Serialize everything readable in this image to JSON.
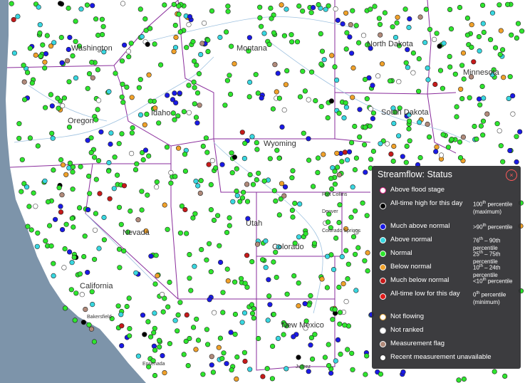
{
  "map": {
    "state_labels": [
      "Washington",
      "Montana",
      "North Dakota",
      "Minnesota",
      "Oregon",
      "Idaho",
      "South Dakota",
      "Wyoming",
      "Nevada",
      "Utah",
      "Colorado",
      "California",
      "New Mexico"
    ],
    "city_labels": [
      "Fort Collins",
      "Denver",
      "Colorado Springs",
      "Bakersfield",
      "Ensenada",
      "Juárez"
    ],
    "colors": {
      "ocean": "#7d94aa",
      "land": "#ffffff",
      "state_border": "#8a2d9c",
      "river": "#9fc2e0"
    }
  },
  "legend": {
    "title": "Streamflow: Status",
    "close_glyph": "×",
    "items": [
      {
        "label": "Above flood stage",
        "range": "",
        "color": "#ffffff",
        "border": "#e6268a",
        "range_sup": "",
        "range_main": "",
        "range_note": ""
      },
      {
        "label": "All-time high for this day",
        "range_main": "100",
        "range_sup": "th",
        "range_rest": " percentile",
        "range_note": "(maximum)",
        "color": "#000000",
        "border": "#ffffff"
      },
      {
        "label": "Much above normal",
        "range_main": ">90",
        "range_sup": "th",
        "range_rest": " percentile",
        "range_note": "",
        "color": "#1a1ae6",
        "border": "#ffffff"
      },
      {
        "label": "Above normal",
        "range_main": "76",
        "range_sup": "th",
        "range_rest": " – 90th percentile",
        "range_note": "",
        "color": "#38d7e0",
        "border": "#ffffff"
      },
      {
        "label": "Normal",
        "range_main": "25",
        "range_sup": "th",
        "range_rest": " – 75th percentile",
        "range_note": "",
        "color": "#2ee62e",
        "border": "#ffffff"
      },
      {
        "label": "Below normal",
        "range_main": "10",
        "range_sup": "th",
        "range_rest": " – 24th percentile",
        "range_note": "",
        "color": "#f0a12a",
        "border": "#ffffff"
      },
      {
        "label": "Much below normal",
        "range_main": "<10",
        "range_sup": "th",
        "range_rest": " percentile",
        "range_note": "",
        "color": "#c61a1a",
        "border": "#ffffff"
      },
      {
        "label": "All-time low for this day",
        "range_main": "0",
        "range_sup": "th",
        "range_rest": " percentile",
        "range_note": "(minimum)",
        "color": "#e01a1a",
        "border": "#ffffff"
      },
      {
        "label": "Not flowing",
        "range_main": "",
        "range_sup": "",
        "range_rest": "",
        "range_note": "",
        "color": "#ffffff",
        "border": "#f2b54a"
      },
      {
        "label": "Not ranked",
        "range_main": "",
        "range_sup": "",
        "range_rest": "",
        "range_note": "",
        "color": "#ffffff",
        "border": "#cccccc"
      },
      {
        "label": "Measurement flag",
        "range_main": "",
        "range_sup": "",
        "range_rest": "",
        "range_note": "",
        "color": "#b08a7a",
        "border": "#ffffff"
      },
      {
        "label": "Recent measurement unavailable",
        "range_main": "",
        "range_sup": "",
        "range_rest": "",
        "range_note": "",
        "color": "#ffffff",
        "border": "#333333"
      }
    ]
  }
}
